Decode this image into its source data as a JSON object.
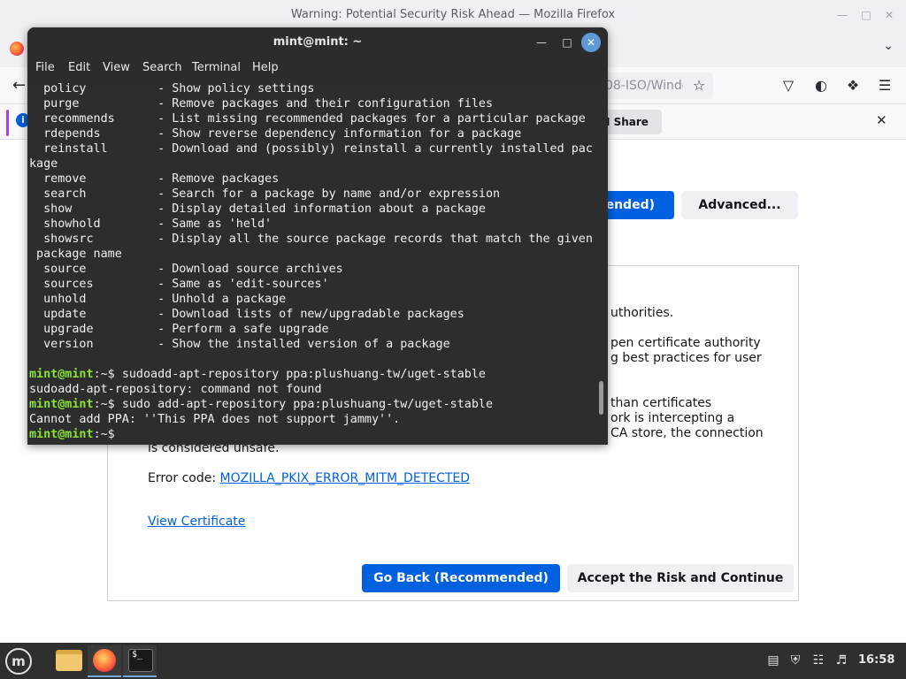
{
  "firefox": {
    "window_title": "Warning: Potential Security Risk Ahead — Mozilla Firefox",
    "url_fragment": "08-ISO/Windo",
    "notification": {
      "share_label": "t I Share"
    },
    "page": {
      "recommended_top_label": "ended)",
      "advanced_label": "Advanced...",
      "paragraph_fragments": [
        "uthorities.",
        "pen certificate authority",
        "g best practices for user",
        "than certificates",
        "ork is intercepting a",
        "CA store, the connection",
        "is considered unsafe."
      ],
      "error_code_label": "Error code: ",
      "error_code": "MOZILLA_PKIX_ERROR_MITM_DETECTED",
      "view_certificate": "View Certificate",
      "go_back_label": "Go Back (Recommended)",
      "accept_label": "Accept the Risk and Continue"
    }
  },
  "terminal": {
    "title": "mint@mint: ~",
    "menu": [
      "File",
      "Edit",
      "View",
      "Search",
      "Terminal",
      "Help"
    ],
    "lines": [
      "  policy          - Show policy settings",
      "  purge           - Remove packages and their configuration files",
      "  recommends      - List missing recommended packages for a particular package",
      "  rdepends        - Show reverse dependency information for a package",
      "  reinstall       - Download and (possibly) reinstall a currently installed pac",
      "kage",
      "  remove          - Remove packages",
      "  search          - Search for a package by name and/or expression",
      "  show            - Display detailed information about a package",
      "  showhold        - Same as 'held'",
      "  showsrc         - Display all the source package records that match the given",
      " package name",
      "  source          - Download source archives",
      "  sources         - Same as 'edit-sources'",
      "  unhold          - Unhold a package",
      "  update          - Download lists of new/upgradable packages",
      "  upgrade         - Perform a safe upgrade",
      "  version         - Show the installed version of a package",
      ""
    ],
    "prompt": "mint@mint",
    "prompt_suffix": ":~$ ",
    "command1": "sudoadd-apt-repository ppa:plushuang-tw/uget-stable",
    "output1": "sudoadd-apt-repository: command not found",
    "command2": "sudo add-apt-repository ppa:plushuang-tw/uget-stable",
    "output2": "Cannot add PPA: ''This PPA does not support jammy''."
  },
  "taskbar": {
    "term_glyph": "$_",
    "clock": "16:58"
  },
  "colors": {
    "accent_blue": "#0061e0",
    "terminal_bg": "#2d2d2d",
    "prompt_green": "#8ae234",
    "taskbar_bg": "#2f2f2f"
  },
  "icons": [
    "firefox-icon",
    "back-arrow-icon",
    "bookmark-star-icon",
    "pocket-icon",
    "account-icon",
    "extensions-icon",
    "menu-icon",
    "info-icon",
    "close-icon",
    "mint-menu-icon",
    "files-icon",
    "terminal-icon",
    "clipboard-icon",
    "shield-icon",
    "network-icon",
    "volume-icon"
  ]
}
